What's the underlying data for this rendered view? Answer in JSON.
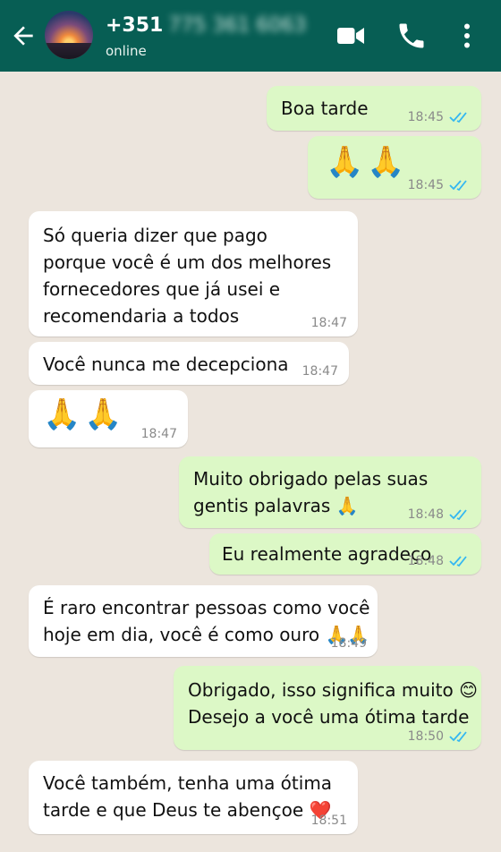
{
  "header": {
    "contact_prefix": "+351",
    "contact_masked": "775 361 6063",
    "status": "online"
  },
  "messages": [
    {
      "dir": "out",
      "text": "Boa tarde",
      "time": "18:45",
      "ticks": "double-blue"
    },
    {
      "dir": "out",
      "text": "🙏🙏",
      "time": "18:45",
      "ticks": "double-blue"
    },
    {
      "dir": "in",
      "text": "Só queria dizer que pago\nporque você é um dos melhores\nfornecedores que já usei e\nrecomendaria a todos",
      "time": "18:47"
    },
    {
      "dir": "in",
      "text": "Você nunca me decepciona",
      "time": "18:47"
    },
    {
      "dir": "in",
      "text": "🙏🙏",
      "time": "18:47"
    },
    {
      "dir": "out",
      "text": "Muito obrigado pelas suas\ngentis palavras 🙏",
      "time": "18:48",
      "ticks": "double-blue"
    },
    {
      "dir": "out",
      "text": "Eu realmente agradeço",
      "time": "18:48",
      "ticks": "double-blue"
    },
    {
      "dir": "in",
      "text": "É raro encontrar pessoas como você\nhoje em dia, você é como ouro 🙏🙏",
      "time": "18:49"
    },
    {
      "dir": "out",
      "text": "Obrigado, isso significa muito 😊\nDesejo a você uma ótima tarde",
      "time": "18:50",
      "ticks": "double-blue"
    },
    {
      "dir": "in",
      "text": "Você também, tenha uma ótima\ntarde e que Deus te abençoe ❤️",
      "time": "18:51"
    }
  ],
  "icons": {
    "back": "arrow-left-icon",
    "video": "video-call-icon",
    "call": "phone-icon",
    "menu": "more-vert-icon",
    "read": "double-check-icon"
  },
  "colors": {
    "header": "#075e54",
    "outgoing": "#dcf8c6",
    "incoming": "#ffffff",
    "background": "#ece5dd",
    "read_tick": "#34b7f1"
  }
}
